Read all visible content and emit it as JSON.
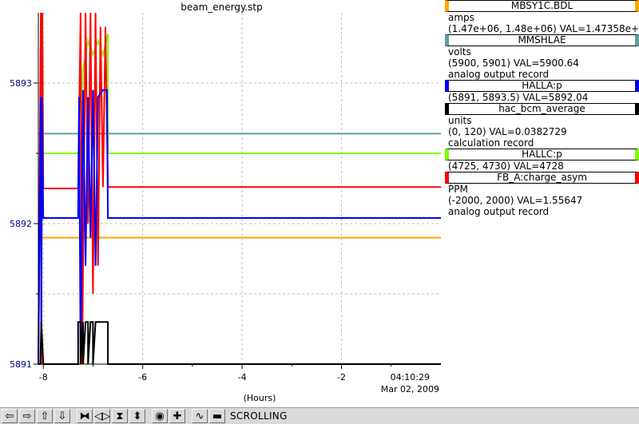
{
  "title": "beam_energy.stp",
  "time_axis": {
    "label": "(Hours)",
    "end_time": "04:10:29",
    "end_date": "Mar 02, 2009"
  },
  "legend": [
    {
      "name": "MBSY1C.BDL",
      "color": "#ffa500",
      "lines": [
        "amps",
        "(1.47e+06, 1.48e+06) VAL=1.47358e+06"
      ]
    },
    {
      "name": "MMSHLAE",
      "color": "#5f9ea0",
      "lines": [
        "volts",
        "(5900, 5901) VAL=5900.64",
        "analog output record"
      ]
    },
    {
      "name": "HALLA:p",
      "color": "#0000ff",
      "lines": [
        "(5891, 5893.5) VAL=5892.04"
      ]
    },
    {
      "name": "hac_bcm_average",
      "color": "#000000",
      "lines": [
        "units",
        "(0, 120) VAL=0.0382729",
        "calculation record"
      ]
    },
    {
      "name": "HALLC:p",
      "color": "#7fff00",
      "lines": [
        "(4725, 4730) VAL=4728"
      ]
    },
    {
      "name": "FB_A:charge_asym",
      "color": "#ff0000",
      "lines": [
        "PPM",
        "(-2000, 2000) VAL=1.55647",
        "analog output record"
      ]
    }
  ],
  "toolbar": {
    "mode_label": "SCROLLING",
    "icons": [
      "scroll-left-icon",
      "scroll-right-icon",
      "scroll-up-icon",
      "scroll-down-icon",
      "zoom-in-x-icon",
      "zoom-out-x-icon",
      "zoom-in-y-icon",
      "zoom-out-y-icon",
      "auto-scale-icon",
      "zoom-in-icon",
      "waveform-icon",
      "zoom-out-icon"
    ]
  },
  "chart_data": {
    "type": "line",
    "title": "beam_energy.stp",
    "xlabel": "(Hours)",
    "ylabel": "",
    "x_ticks": [
      -8,
      -6,
      -4,
      -2
    ],
    "xlim": [
      -8.1,
      0
    ],
    "y_ticks": [
      5891,
      5892,
      5893
    ],
    "ylim": [
      5891,
      5893.5
    ],
    "grid": true,
    "series": [
      {
        "name": "MBSY1C.BDL",
        "color": "#ffa500",
        "x": [
          -8.1,
          0
        ],
        "y": [
          5891.9,
          5891.9
        ]
      },
      {
        "name": "MMSHLAE",
        "color": "#5f9ea0",
        "x": [
          -8.1,
          0
        ],
        "y": [
          5892.64,
          5892.64
        ]
      },
      {
        "name": "HALLC:p",
        "color": "#7fff00",
        "x": [
          -8.1,
          -8.05,
          -8.03,
          -8.0,
          -7.75,
          -7.25,
          -7.2,
          -7.1,
          -7.0,
          -6.9,
          -6.8,
          -6.7,
          -6.7,
          0
        ],
        "y": [
          5891,
          5893.1,
          5893.3,
          5892.5,
          5892.5,
          5892.5,
          5893.1,
          5893.3,
          5893.2,
          5893.3,
          5893.2,
          5893.35,
          5892.5,
          5892.5
        ]
      },
      {
        "name": "FB_A:charge_asym",
        "color": "#ff0000",
        "x": [
          -8.1,
          -8.05,
          -8.04,
          -8.02,
          -8.0,
          -7.9,
          -7.3,
          -7.25,
          -7.22,
          -7.15,
          -7.1,
          -7.05,
          -7.0,
          -6.95,
          -6.9,
          -6.85,
          -6.8,
          -6.75,
          -6.7,
          0
        ],
        "y": [
          5891,
          5893.5,
          5891,
          5893.5,
          5892.25,
          5892.25,
          5892.25,
          5893.5,
          5891,
          5893.5,
          5892,
          5893.5,
          5891.5,
          5893.5,
          5891.7,
          5893.4,
          5892.26,
          5893.4,
          5892.26,
          5892.26
        ]
      },
      {
        "name": "HALLA:p",
        "color": "#0000ff",
        "x": [
          -8.1,
          -8.05,
          -8.04,
          -8.03,
          -8.0,
          -7.8,
          -7.3,
          -7.28,
          -7.25,
          -7.2,
          -7.15,
          -7.1,
          -7.05,
          -7.0,
          -6.95,
          -6.9,
          -6.8,
          -6.72,
          -6.7,
          0
        ],
        "y": [
          5891,
          5892.9,
          5891.2,
          5892.9,
          5892.04,
          5892.04,
          5892.04,
          5892.9,
          5891,
          5892.95,
          5891.7,
          5892.9,
          5891.9,
          5892.95,
          5891.7,
          5892.9,
          5892.95,
          5892.95,
          5892.04,
          5892.04
        ]
      },
      {
        "name": "hac_bcm_average",
        "color": "#000000",
        "x": [
          -8.1,
          -8.06,
          -8.04,
          -8.0,
          -7.3,
          -7.3,
          -7.25,
          -7.25,
          -7.2,
          -7.2,
          -7.15,
          -7.1,
          -7.1,
          -7.05,
          -7.0,
          -7.0,
          -6.95,
          -6.7,
          -6.7,
          0
        ],
        "y": [
          5891,
          5891,
          5891.3,
          5891,
          5891,
          5891.3,
          5891.3,
          5891,
          5891.3,
          5891,
          5891.3,
          5891.3,
          5891,
          5891.3,
          5891.3,
          5891,
          5891.3,
          5891.3,
          5891,
          5891
        ]
      }
    ]
  }
}
